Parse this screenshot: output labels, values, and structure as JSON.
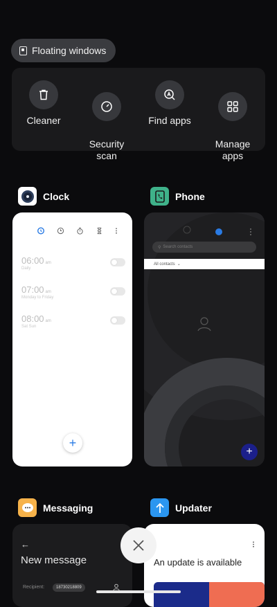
{
  "floating_windows": {
    "label": "Floating windows",
    "icon": "floating-window-icon"
  },
  "quick_actions": [
    {
      "label": "Cleaner",
      "icon": "trash-icon"
    },
    {
      "label": "Security\nscan",
      "icon": "security-scan-icon"
    },
    {
      "label": "Find apps",
      "icon": "find-apps-icon"
    },
    {
      "label": "Manage\napps",
      "icon": "grid-icon"
    }
  ],
  "apps": {
    "clock": {
      "name": "Clock",
      "icon_color": "#ffffff",
      "alarms": [
        {
          "time": "06:00",
          "ampm": "am",
          "repeat": "Daily"
        },
        {
          "time": "07:00",
          "ampm": "am",
          "repeat": "Monday to Friday"
        },
        {
          "time": "08:00",
          "ampm": "am",
          "repeat": "Sat Sun"
        }
      ]
    },
    "phone": {
      "name": "Phone",
      "icon_color": "#3fb28a",
      "search_placeholder": "Search contacts",
      "contacts_filter": "All contacts"
    },
    "messaging": {
      "name": "Messaging",
      "icon_color": "#f6b24a",
      "title": "New message",
      "recipient_label": "Recipient:",
      "recipient_value": "18730218809"
    },
    "updater": {
      "name": "Updater",
      "icon_color": "#2b96f0",
      "text": "An update is available"
    }
  },
  "colors": {
    "background": "#0b0b0d",
    "accent_blue": "#2a7be4"
  }
}
